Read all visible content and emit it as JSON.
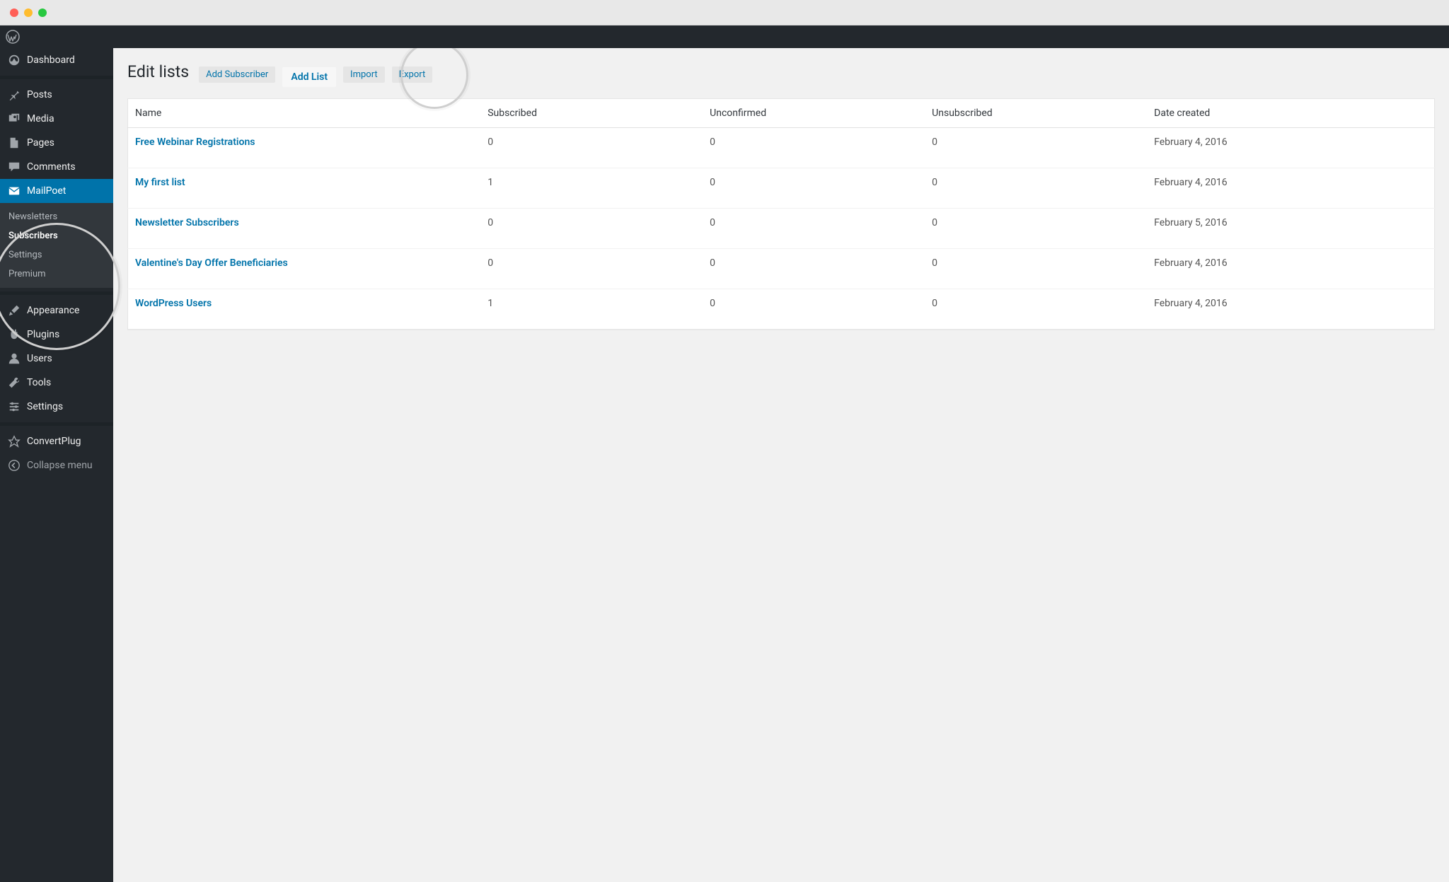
{
  "sidebar": {
    "items": [
      {
        "id": "dashboard",
        "label": "Dashboard"
      },
      {
        "id": "posts",
        "label": "Posts"
      },
      {
        "id": "media",
        "label": "Media"
      },
      {
        "id": "pages",
        "label": "Pages"
      },
      {
        "id": "comments",
        "label": "Comments"
      },
      {
        "id": "mailpoet",
        "label": "MailPoet"
      },
      {
        "id": "appearance",
        "label": "Appearance"
      },
      {
        "id": "plugins",
        "label": "Plugins"
      },
      {
        "id": "users",
        "label": "Users"
      },
      {
        "id": "tools",
        "label": "Tools"
      },
      {
        "id": "settings",
        "label": "Settings"
      },
      {
        "id": "convertplug",
        "label": "ConvertPlug"
      }
    ],
    "submenu": [
      {
        "label": "Newsletters"
      },
      {
        "label": "Subscribers"
      },
      {
        "label": "Settings"
      },
      {
        "label": "Premium"
      }
    ],
    "collapse_label": "Collapse menu"
  },
  "page": {
    "title": "Edit lists",
    "actions": {
      "add_subscriber": "Add Subscriber",
      "add_list": "Add List",
      "import": "Import",
      "export": "Export"
    }
  },
  "table": {
    "headers": {
      "name": "Name",
      "subscribed": "Subscribed",
      "unconfirmed": "Unconfirmed",
      "unsubscribed": "Unsubscribed",
      "date": "Date created"
    },
    "rows": [
      {
        "name": "Free Webinar Registrations",
        "subscribed": "0",
        "unconfirmed": "0",
        "unsubscribed": "0",
        "date": "February 4, 2016"
      },
      {
        "name": "My first list",
        "subscribed": "1",
        "unconfirmed": "0",
        "unsubscribed": "0",
        "date": "February 4, 2016"
      },
      {
        "name": "Newsletter Subscribers",
        "subscribed": "0",
        "unconfirmed": "0",
        "unsubscribed": "0",
        "date": "February 5, 2016"
      },
      {
        "name": "Valentine's Day Offer Beneficiaries",
        "subscribed": "0",
        "unconfirmed": "0",
        "unsubscribed": "0",
        "date": "February 4, 2016"
      },
      {
        "name": "WordPress Users",
        "subscribed": "1",
        "unconfirmed": "0",
        "unsubscribed": "0",
        "date": "February 4, 2016"
      }
    ]
  }
}
